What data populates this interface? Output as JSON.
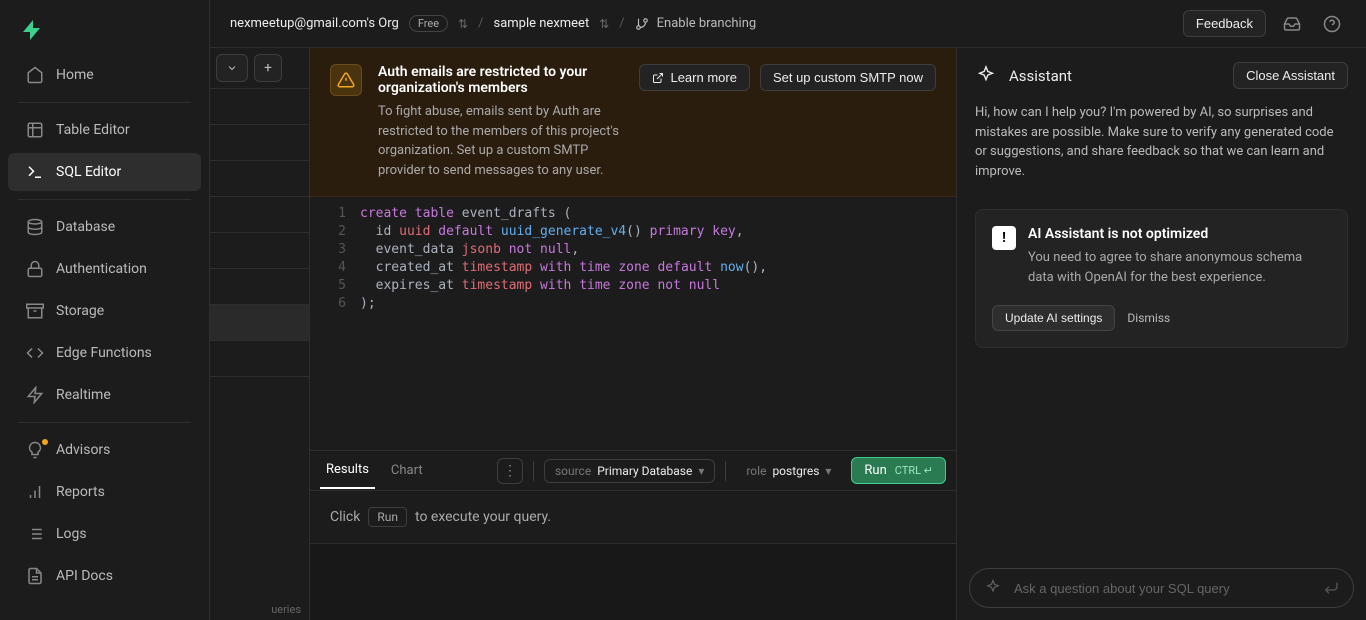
{
  "sidebar": {
    "items": [
      {
        "label": "Home"
      },
      {
        "label": "Table Editor"
      },
      {
        "label": "SQL Editor"
      },
      {
        "label": "Database"
      },
      {
        "label": "Authentication"
      },
      {
        "label": "Storage"
      },
      {
        "label": "Edge Functions"
      },
      {
        "label": "Realtime"
      },
      {
        "label": "Advisors"
      },
      {
        "label": "Reports"
      },
      {
        "label": "Logs"
      },
      {
        "label": "API Docs"
      }
    ]
  },
  "topbar": {
    "org": "nexmeetup@gmail.com's Org",
    "plan": "Free",
    "project": "sample nexmeet",
    "branching": "Enable branching",
    "feedback": "Feedback"
  },
  "alert": {
    "title": "Auth emails are restricted to your organization's members",
    "body": "To fight abuse, emails sent by Auth are restricted to the members of this project's organization. Set up a custom SMTP provider to send messages to any user.",
    "learn_more": "Learn more",
    "setup": "Set up custom SMTP now"
  },
  "editor": {
    "lines": [
      "1",
      "2",
      "3",
      "4",
      "5",
      "6"
    ],
    "code_plain": "create table event_drafts (\n  id uuid default uuid_generate_v4() primary key,\n  event_data jsonb not null,\n  created_at timestamp with time zone default now(),\n  expires_at timestamp with time zone not null\n);"
  },
  "resultsbar": {
    "results_tab": "Results",
    "chart_tab": "Chart",
    "source_label": "source",
    "source_value": "Primary Database",
    "role_label": "role",
    "role_value": "postgres",
    "run": "Run",
    "run_hint": "CTRL ↵"
  },
  "results": {
    "click": "Click",
    "run_chip": "Run",
    "suffix": "to execute your query."
  },
  "assistant": {
    "title": "Assistant",
    "close": "Close Assistant",
    "intro": "Hi, how can I help you? I'm powered by AI, so surprises and mistakes are possible. Make sure to verify any generated code or suggestions, and share feedback so that we can learn and improve.",
    "card_title": "AI Assistant is not optimized",
    "card_body": "You need to agree to share anonymous schema data with OpenAI for the best experience.",
    "update": "Update AI settings",
    "dismiss": "Dismiss",
    "placeholder": "Ask a question about your SQL query"
  },
  "left_strip_bottom": "ueries",
  "colors": {
    "brand": "#3ecf8e",
    "warning": "#f5a623"
  }
}
